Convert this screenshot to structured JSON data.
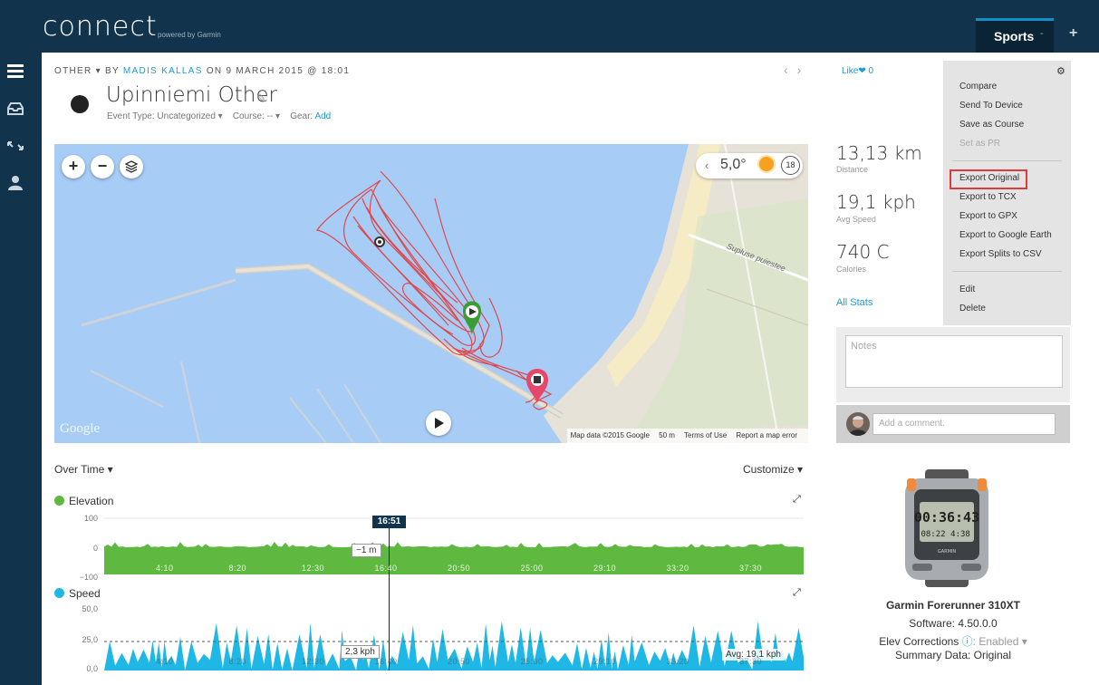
{
  "header": {
    "logo": "connect",
    "logo_sub": "powered by Garmin",
    "active_tab": "Sports",
    "tab_caret": "-",
    "add_label": "+"
  },
  "breadcrumb": {
    "type": "OTHER",
    "by": "BY",
    "author": "MADIS KALLAS",
    "on": "ON 9 MARCH 2015 @ 18:01"
  },
  "activity": {
    "title": "Upinniemi Other",
    "event_type_label": "Event Type: Uncategorized",
    "course_label": "Course: --",
    "gear_label": "Gear:",
    "gear_link": "Add"
  },
  "map": {
    "zoom_in": "+",
    "zoom_out": "−",
    "temperature": "5,0°",
    "wind": "18",
    "street": "Supluse puiestee",
    "google": "Google",
    "attribution": [
      "Map data ©2015 Google",
      "50 m",
      "Terms of Use",
      "Report a map error"
    ]
  },
  "charts": {
    "over_time": "Over Time",
    "customize": "Customize",
    "cursor_time": "16:51",
    "elevation": {
      "label": "Elevation",
      "color": "#5fb83f",
      "y_ticks": [
        "100",
        "0",
        "−100"
      ],
      "x_ticks": [
        "4:10",
        "8:20",
        "12:30",
        "16:40",
        "20:50",
        "25:00",
        "29:10",
        "33:20",
        "37:30"
      ],
      "tooltip": "−1 m"
    },
    "speed": {
      "label": "Speed",
      "color": "#1fb8e6",
      "y_ticks": [
        "50,0",
        "25,0",
        "0,0"
      ],
      "x_ticks": [
        "4:10",
        "8:20",
        "12:30",
        "16:40",
        "20:50",
        "25:00",
        "29:10",
        "33:20",
        "37:30"
      ],
      "tooltip": "2,3 kph",
      "avg": "Avg: 19,1 kph"
    }
  },
  "social": {
    "like": "Like",
    "like_count": "0"
  },
  "stats": [
    {
      "value": "13,13 km",
      "label": "Distance"
    },
    {
      "value": "19,1 kph",
      "label": "Avg Speed"
    },
    {
      "value": "740 C",
      "label": "Calories"
    }
  ],
  "all_stats": "All Stats",
  "menu": {
    "items": [
      "Compare",
      "Send To Device",
      "Save as Course",
      "Set as PR",
      "Export Original",
      "Export to TCX",
      "Export to GPX",
      "Export to Google Earth",
      "Export Splits to CSV",
      "Edit",
      "Delete"
    ]
  },
  "notes": {
    "placeholder": "Notes",
    "comment_placeholder": "Add a comment."
  },
  "device": {
    "name": "Garmin Forerunner 310XT",
    "software": "Software: 4.50.0.0",
    "elev_label": "Elev Corrections",
    "elev_value": ": Enabled",
    "summary": "Summary Data: Original",
    "screen_time": "00:36:43",
    "screen_sub1": "08:22",
    "screen_sub2": "4:38",
    "brand": "GARMIN"
  }
}
